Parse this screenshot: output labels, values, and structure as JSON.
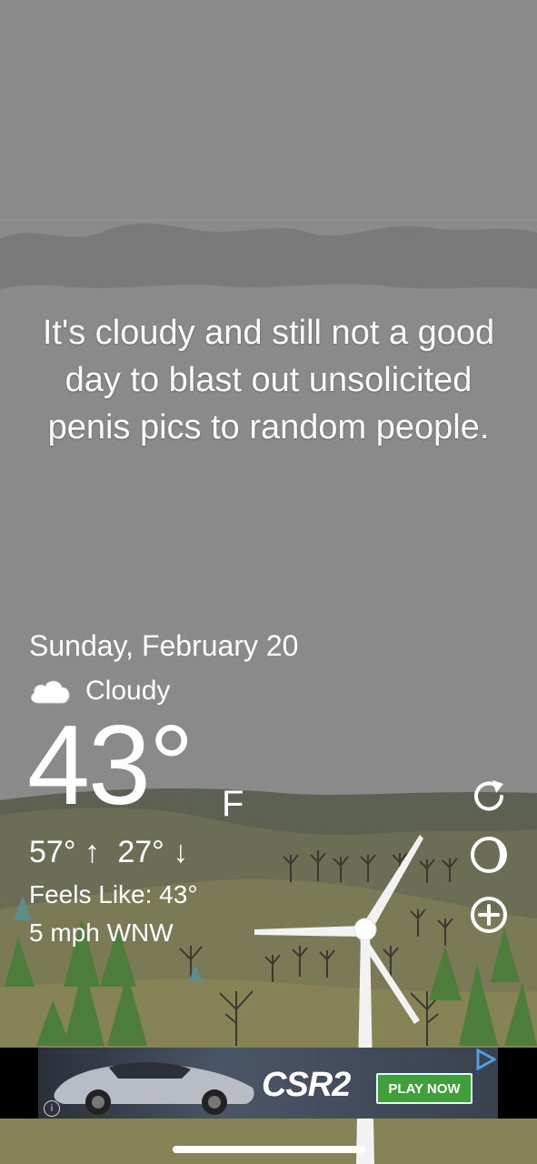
{
  "message": "It's cloudy and still not a good day to blast out unsolicited penis pics to random people.",
  "date": "Sunday, February 20",
  "condition": {
    "label": "Cloudy",
    "icon": "cloud-icon"
  },
  "temperature": {
    "value": "43°",
    "unit": "F"
  },
  "hi_lo": {
    "high": "57°",
    "low": "27°",
    "up_arrow": "↑",
    "down_arrow": "↓"
  },
  "feels_like": "Feels Like: 43°",
  "wind": "5 mph WNW",
  "side_actions": [
    {
      "icon": "refresh-icon"
    },
    {
      "icon": "dark-mode-icon"
    },
    {
      "icon": "add-icon"
    }
  ],
  "ad": {
    "brand": "CSR2",
    "cta": "PLAY NOW",
    "info": "i"
  },
  "colors": {
    "sky": "#8a8a8a",
    "hill_dark": "#5a5f50",
    "hill_mid": "#76775a",
    "ground": "#8b8a5e",
    "tree": "#4a7a3a",
    "ad_green": "#3fa03a"
  }
}
